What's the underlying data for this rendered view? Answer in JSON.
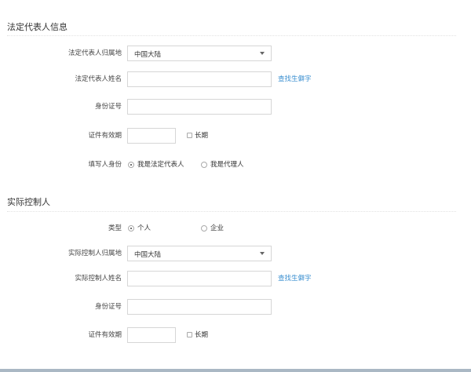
{
  "legal_rep": {
    "title": "法定代表人信息",
    "region_label": "法定代表人归属地",
    "region_value": "中国大陆",
    "name_label": "法定代表人姓名",
    "name_value": "",
    "rare_char_link": "查找生僻字",
    "id_label": "身份证号",
    "id_value": "",
    "validity_label": "证件有效期",
    "validity_value": "",
    "long_term_label": "长期",
    "long_term_checked": false,
    "filler_label": "填写人身份",
    "filler_options": [
      "我是法定代表人",
      "我是代理人"
    ],
    "filler_selected": 0
  },
  "controller": {
    "title": "实际控制人",
    "type_label": "类型",
    "type_options": [
      "个人",
      "企业"
    ],
    "type_selected": 0,
    "region_label": "实际控制人归属地",
    "region_value": "中国大陆",
    "name_label": "实际控制人姓名",
    "name_value": "",
    "rare_char_link": "查找生僻字",
    "id_label": "身份证号",
    "id_value": "",
    "validity_label": "证件有效期",
    "validity_value": "",
    "long_term_label": "长期",
    "long_term_checked": false
  }
}
